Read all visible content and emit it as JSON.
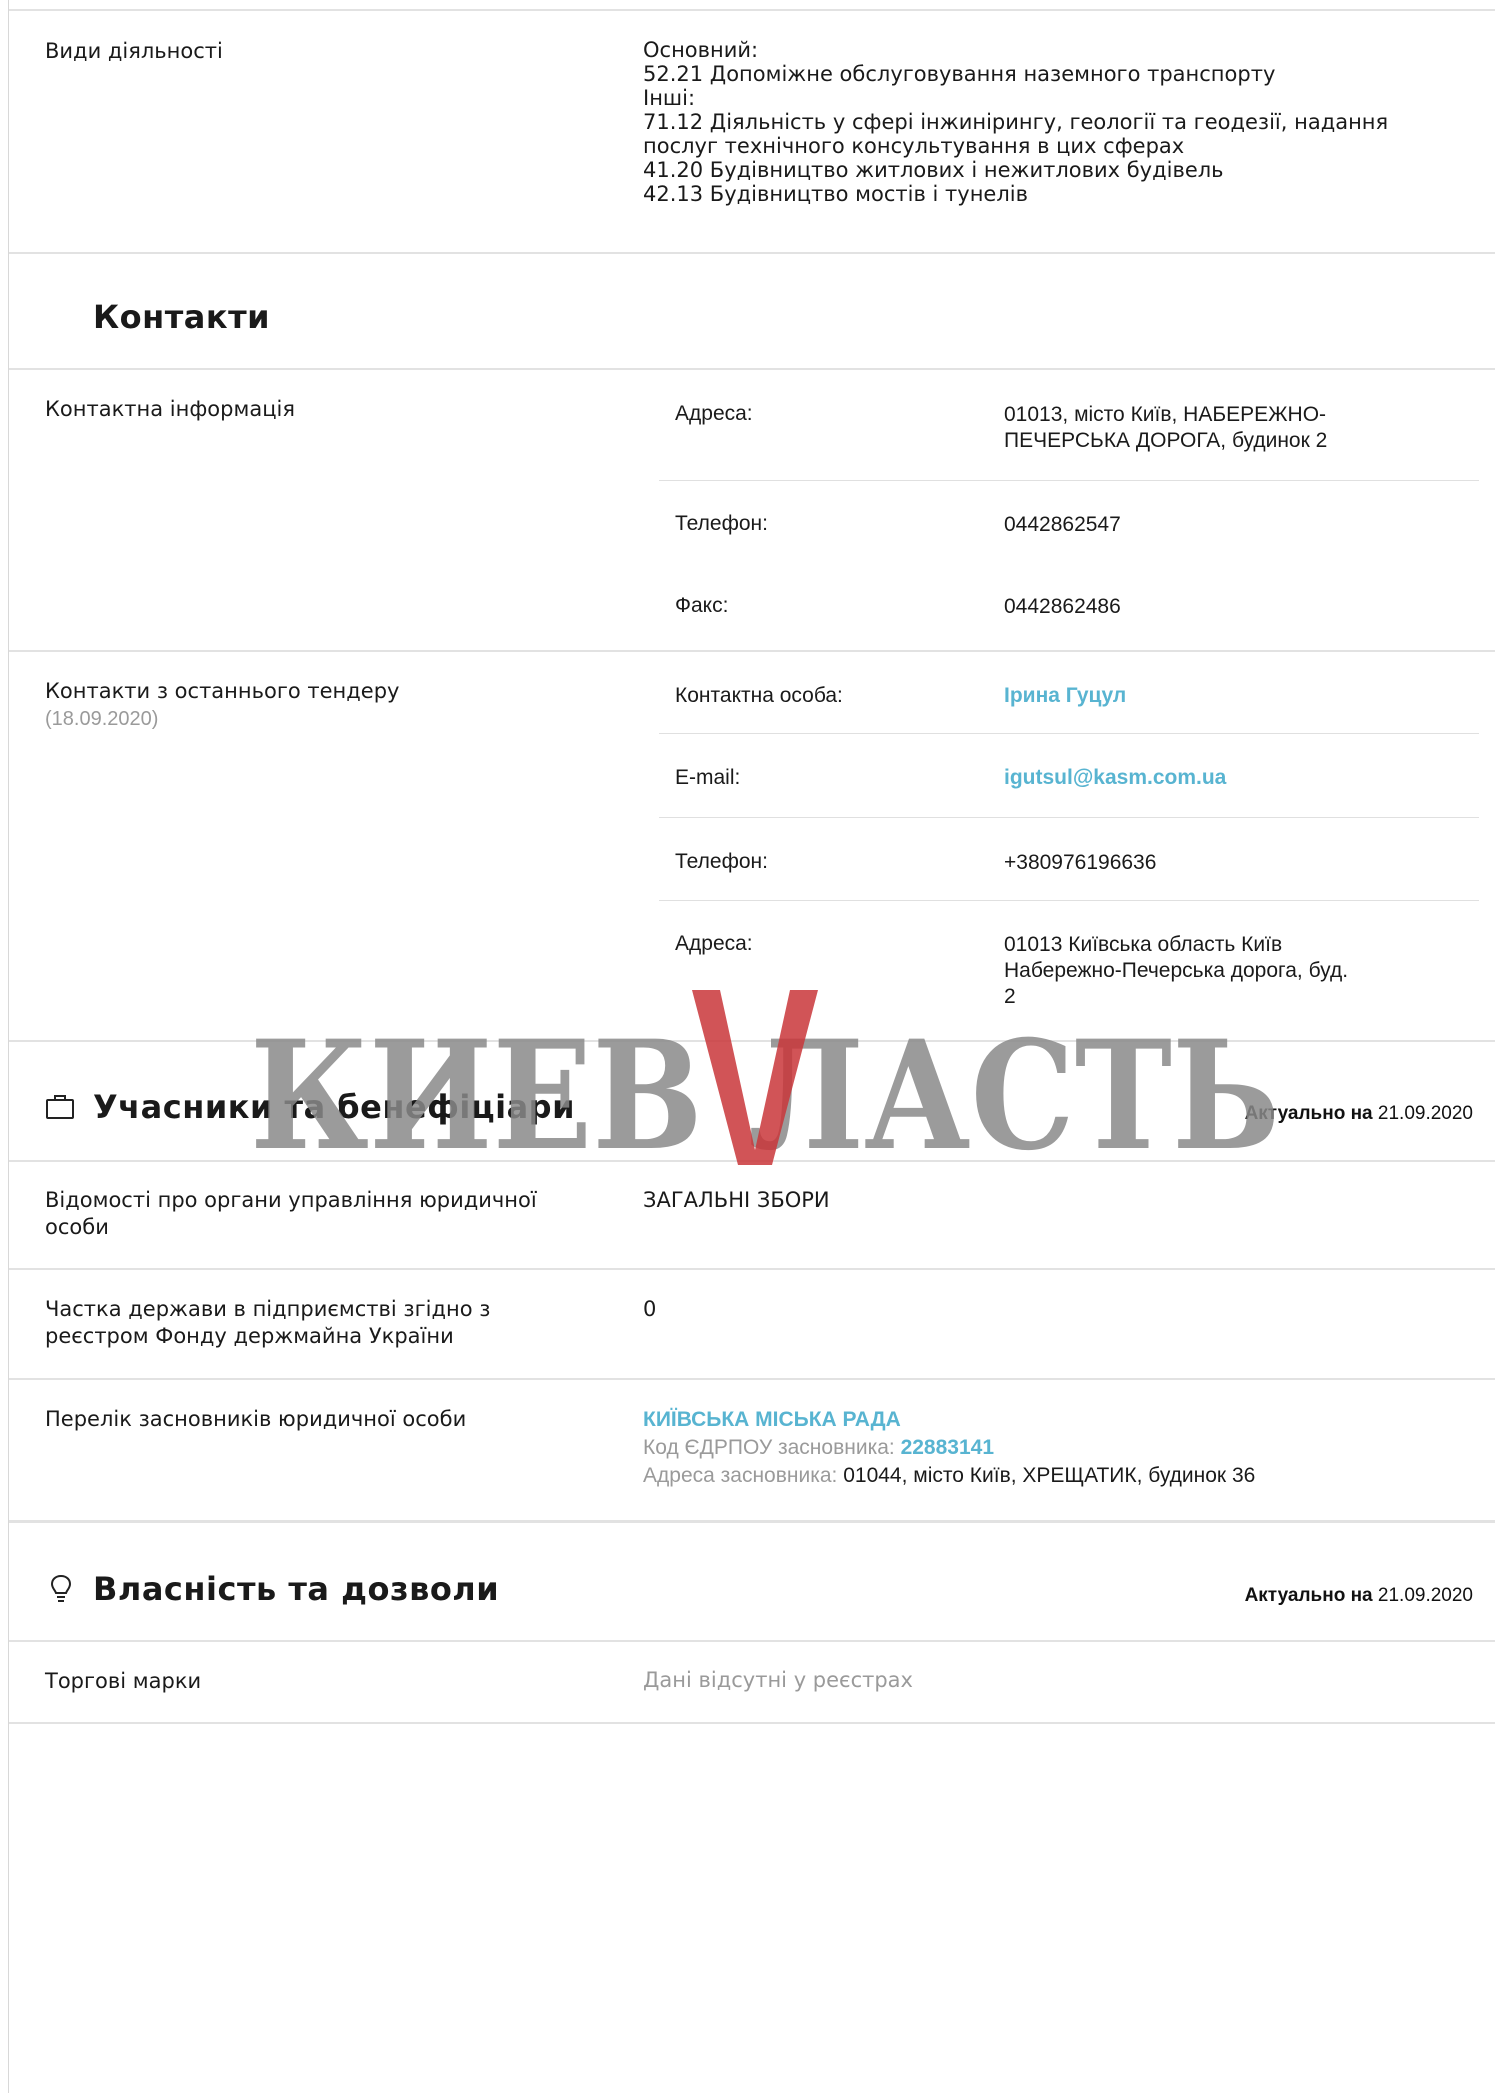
{
  "activities": {
    "label": "Види діяльності",
    "main_title": "Основний:",
    "main_item": "52.21 Допоміжне обслуговування наземного транспорту",
    "other_title": "Інші:",
    "other_items": [
      "71.12 Діяльність у сфері інжинірингу, геології та геодезії, надання",
      "послуг технічного консультування в цих сферах",
      "41.20 Будівництво житлових і нежитлових будівель",
      "42.13 Будівництво мостів і тунелів"
    ]
  },
  "contacts": {
    "title": "Контакти",
    "info_label": "Контактна інформація",
    "address_label": "Адреса:",
    "address_value_1": "01013, місто Київ, НАБЕРЕЖНО-",
    "address_value_2": "ПЕЧЕРСЬКА ДОРОГА, будинок 2",
    "phone_label": "Телефон:",
    "phone_value": "0442862547",
    "fax_label": "Факс:",
    "fax_value": "0442862486",
    "tender_label": "Контакти з останнього тендеру",
    "tender_date": "(18.09.2020)",
    "person_label": "Контактна особа:",
    "person_value": "Ірина Гуцул",
    "email_label": "E-mail:",
    "email_value": "igutsul@kasm.com.ua",
    "tender_phone_label": "Телефон:",
    "tender_phone_value": "+380976196636",
    "tender_address_label": "Адреса:",
    "tender_address_1": "01013 Київська область Київ",
    "tender_address_2": "Набережно-Печерська дорога, буд.",
    "tender_address_3": "2"
  },
  "participants": {
    "title": "Учасники та бенефіціари",
    "actual_label": "Актуально на",
    "actual_date": "21.09.2020",
    "governance_label_1": "Відомості про органи управління юридичної",
    "governance_label_2": "особи",
    "governance_value": "ЗАГАЛЬНІ ЗБОРИ",
    "state_share_label_1": "Частка держави в підприємстві згідно з",
    "state_share_label_2": "реєстром Фонду держмайна України",
    "state_share_value": "0",
    "founders_label": "Перелік засновників юридичної особи",
    "founder_name": "КИЇВСЬКА МІСЬКА РАДА",
    "founder_code_label": "Код ЄДРПОУ засновника:",
    "founder_code": "22883141",
    "founder_address_label": "Адреса засновника:",
    "founder_address": "01044, місто Київ, ХРЕЩАТИК, будинок 36"
  },
  "property": {
    "title": "Власність та дозволи",
    "actual_label": "Актуально на",
    "actual_date": "21.09.2020",
    "trademarks_label": "Торгові марки",
    "trademarks_value": "Дані відсутні у реєстрах"
  },
  "watermark": {
    "text": "КИЕВВЛАСТЬ",
    "gray": "#8a8a8a",
    "red": "#c9363a"
  },
  "colors": {
    "link": "#58b4d1",
    "border": "#e2e2e2",
    "muted": "#9a9a9a"
  }
}
